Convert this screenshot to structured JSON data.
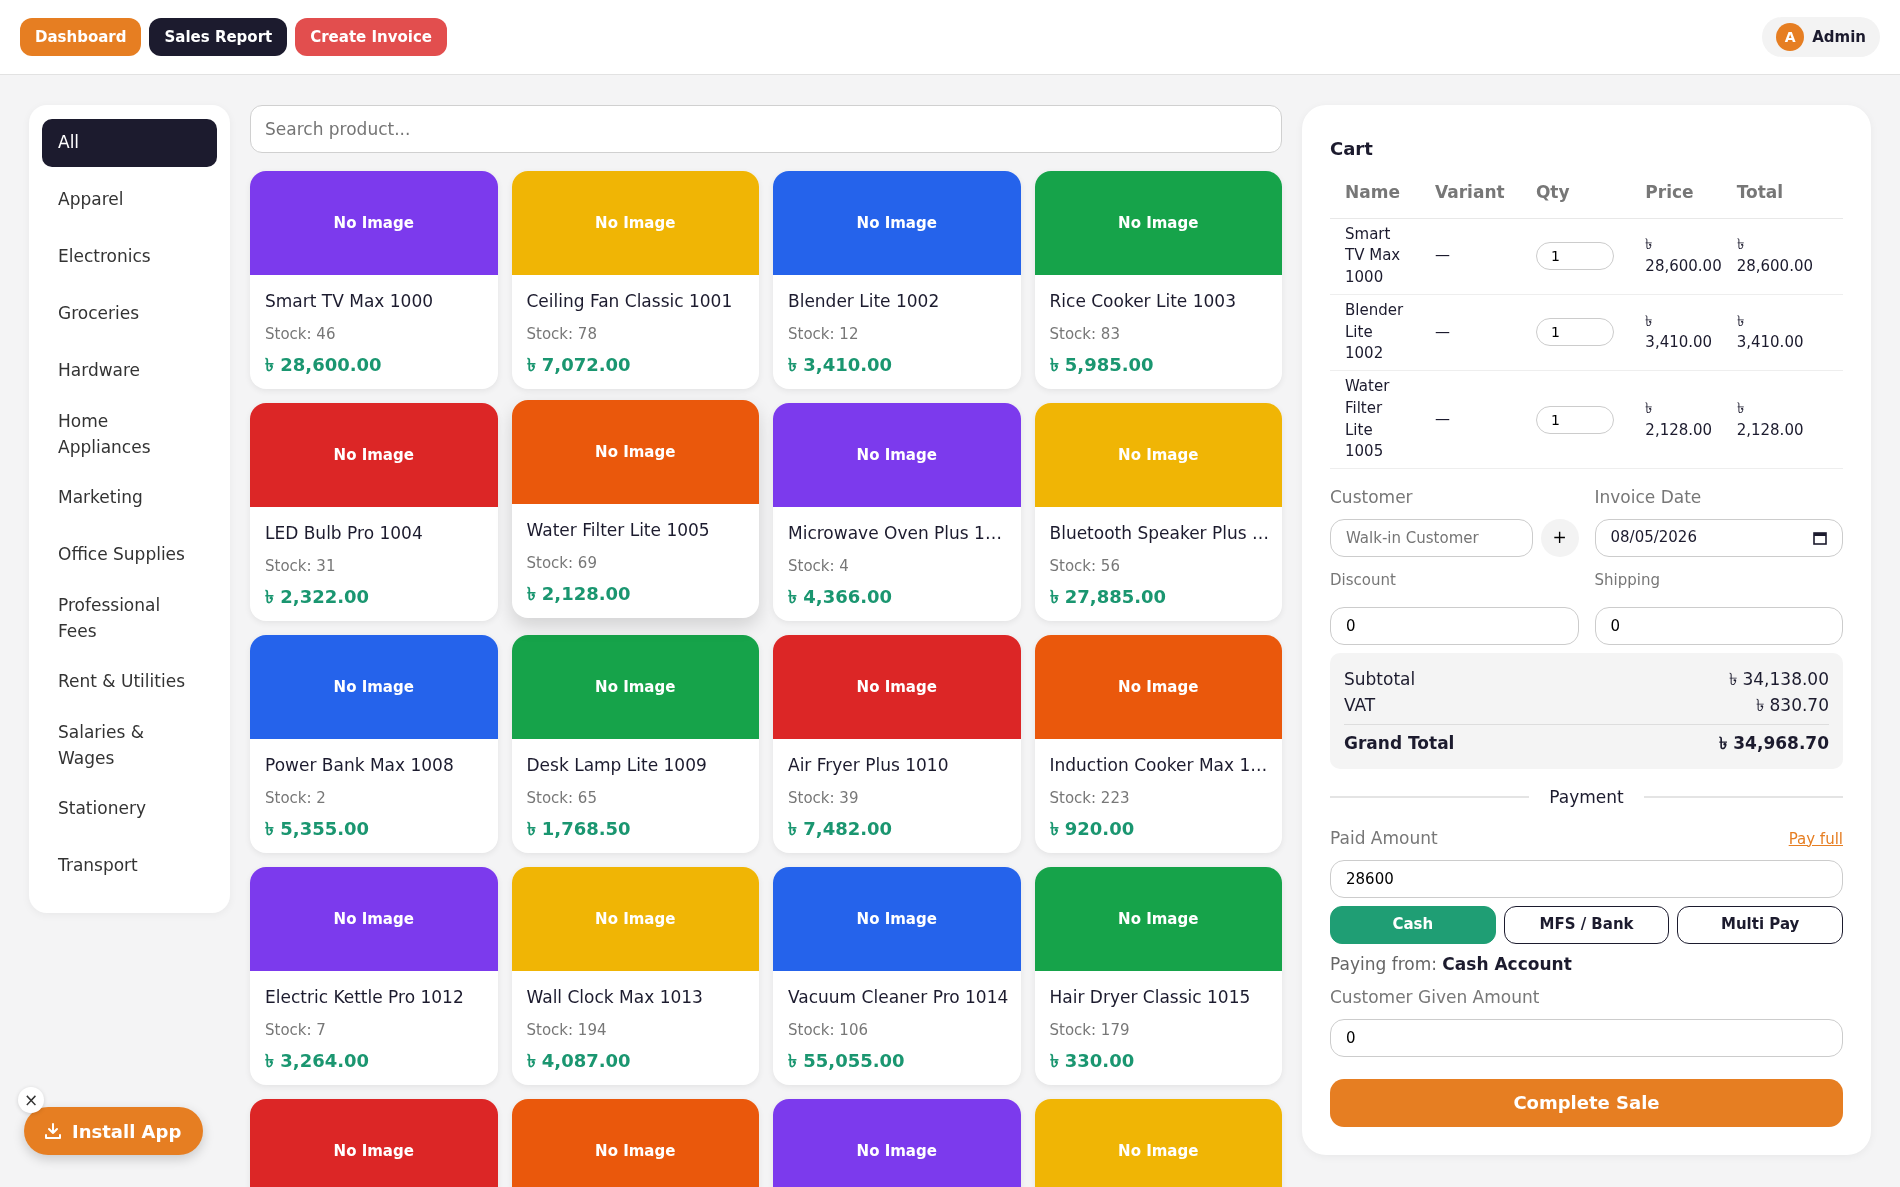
{
  "topbar": {
    "buttons": [
      {
        "label": "Dashboard",
        "kind": "orange"
      },
      {
        "label": "Sales Report",
        "kind": "dark"
      },
      {
        "label": "Create Invoice",
        "kind": "red"
      }
    ],
    "user": {
      "initial": "A",
      "name": "Admin"
    }
  },
  "categories": [
    {
      "label": "All",
      "selected": true
    },
    {
      "label": "Apparel",
      "selected": false
    },
    {
      "label": "Electronics",
      "selected": false
    },
    {
      "label": "Groceries",
      "selected": false
    },
    {
      "label": "Hardware",
      "selected": false
    },
    {
      "label": "Home Appliances",
      "selected": false
    },
    {
      "label": "Marketing",
      "selected": false
    },
    {
      "label": "Office Supplies",
      "selected": false
    },
    {
      "label": "Professional Fees",
      "selected": false
    },
    {
      "label": "Rent & Utilities",
      "selected": false
    },
    {
      "label": "Salaries & Wages",
      "selected": false
    },
    {
      "label": "Stationery",
      "selected": false
    },
    {
      "label": "Transport",
      "selected": false
    }
  ],
  "search": {
    "placeholder": "Search product..."
  },
  "products": [
    {
      "image_label": "No Image",
      "color": "#7c3aed",
      "name": "Smart TV Max 1000",
      "stock": "Stock: 46",
      "price": "৳ 28,600.00",
      "hovered": false
    },
    {
      "image_label": "No Image",
      "color": "#f0b505",
      "name": "Ceiling Fan Classic 1001",
      "stock": "Stock: 78",
      "price": "৳ 7,072.00",
      "hovered": false
    },
    {
      "image_label": "No Image",
      "color": "#2563eb",
      "name": "Blender Lite 1002",
      "stock": "Stock: 12",
      "price": "৳ 3,410.00",
      "hovered": false
    },
    {
      "image_label": "No Image",
      "color": "#16a34a",
      "name": "Rice Cooker Lite 1003",
      "stock": "Stock: 83",
      "price": "৳ 5,985.00",
      "hovered": false
    },
    {
      "image_label": "No Image",
      "color": "#dc2626",
      "name": "LED Bulb Pro 1004",
      "stock": "Stock: 31",
      "price": "৳ 2,322.00",
      "hovered": false
    },
    {
      "image_label": "No Image",
      "color": "#ea580c",
      "name": "Water Filter Lite 1005",
      "stock": "Stock: 69",
      "price": "৳ 2,128.00",
      "hovered": true
    },
    {
      "image_label": "No Image",
      "color": "#7c3aed",
      "name": "Microwave Oven Plus 1…",
      "stock": "Stock: 4",
      "price": "৳ 4,366.00",
      "hovered": false
    },
    {
      "image_label": "No Image",
      "color": "#f0b505",
      "name": "Bluetooth Speaker Plus …",
      "stock": "Stock: 56",
      "price": "৳ 27,885.00",
      "hovered": false
    },
    {
      "image_label": "No Image",
      "color": "#2563eb",
      "name": "Power Bank Max 1008",
      "stock": "Stock: 2",
      "price": "৳ 5,355.00",
      "hovered": false
    },
    {
      "image_label": "No Image",
      "color": "#16a34a",
      "name": "Desk Lamp Lite 1009",
      "stock": "Stock: 65",
      "price": "৳ 1,768.50",
      "hovered": false
    },
    {
      "image_label": "No Image",
      "color": "#dc2626",
      "name": "Air Fryer Plus 1010",
      "stock": "Stock: 39",
      "price": "৳ 7,482.00",
      "hovered": false
    },
    {
      "image_label": "No Image",
      "color": "#ea580c",
      "name": "Induction Cooker Max 1…",
      "stock": "Stock: 223",
      "price": "৳ 920.00",
      "hovered": false
    },
    {
      "image_label": "No Image",
      "color": "#7c3aed",
      "name": "Electric Kettle Pro 1012",
      "stock": "Stock: 7",
      "price": "৳ 3,264.00",
      "hovered": false
    },
    {
      "image_label": "No Image",
      "color": "#f0b505",
      "name": "Wall Clock Max 1013",
      "stock": "Stock: 194",
      "price": "৳ 4,087.00",
      "hovered": false
    },
    {
      "image_label": "No Image",
      "color": "#2563eb",
      "name": "Vacuum Cleaner Pro 1014",
      "stock": "Stock: 106",
      "price": "৳ 55,055.00",
      "hovered": false
    },
    {
      "image_label": "No Image",
      "color": "#16a34a",
      "name": "Hair Dryer Classic 1015",
      "stock": "Stock: 179",
      "price": "৳ 330.00",
      "hovered": false
    },
    {
      "image_label": "No Image",
      "color": "#dc2626"
    },
    {
      "image_label": "No Image",
      "color": "#ea580c"
    },
    {
      "image_label": "No Image",
      "color": "#7c3aed"
    },
    {
      "image_label": "No Image",
      "color": "#f0b505"
    }
  ],
  "cart": {
    "title": "Cart",
    "columns": [
      "Name",
      "Variant",
      "Qty",
      "Price",
      "Total"
    ],
    "rows": [
      {
        "name": "Smart TV Max 1000",
        "variant": "—",
        "qty": "1",
        "price": "৳ 28,600.00",
        "total": "৳ 28,600.00"
      },
      {
        "name": "Blender Lite 1002",
        "variant": "—",
        "qty": "1",
        "price": "৳ 3,410.00",
        "total": "৳ 3,410.00"
      },
      {
        "name": "Water Filter Lite 1005",
        "variant": "—",
        "qty": "1",
        "price": "৳ 2,128.00",
        "total": "৳ 2,128.00"
      }
    ],
    "customer": {
      "label": "Customer",
      "placeholder": "Walk-in Customer",
      "add": "+"
    },
    "invoice_date": {
      "label": "Invoice Date",
      "value": "08/05/2026"
    },
    "discount": {
      "label": "Discount",
      "value": "0"
    },
    "shipping": {
      "label": "Shipping",
      "value": "0"
    },
    "summary": [
      {
        "label": "Subtotal",
        "value": "৳ 34,138.00",
        "kind": "normal"
      },
      {
        "label": "VAT",
        "value": "৳ 830.70",
        "kind": "normal"
      },
      {
        "label": "Grand Total",
        "value": "৳ 34,968.70",
        "kind": "grand"
      }
    ],
    "payment_heading": "Payment",
    "paid_amount": {
      "label": "Paid Amount",
      "link": "Pay full",
      "value": "28600"
    },
    "methods": [
      {
        "label": "Cash",
        "selected": true
      },
      {
        "label": "MFS / Bank",
        "selected": false
      },
      {
        "label": "Multi Pay",
        "selected": false
      }
    ],
    "paying_from": "Paying from: **Cash Account**",
    "given_amount": {
      "label": "Customer Given Amount",
      "value": "0"
    },
    "submit": "Complete Sale"
  },
  "install": {
    "close": "×",
    "label": "Install App"
  }
}
